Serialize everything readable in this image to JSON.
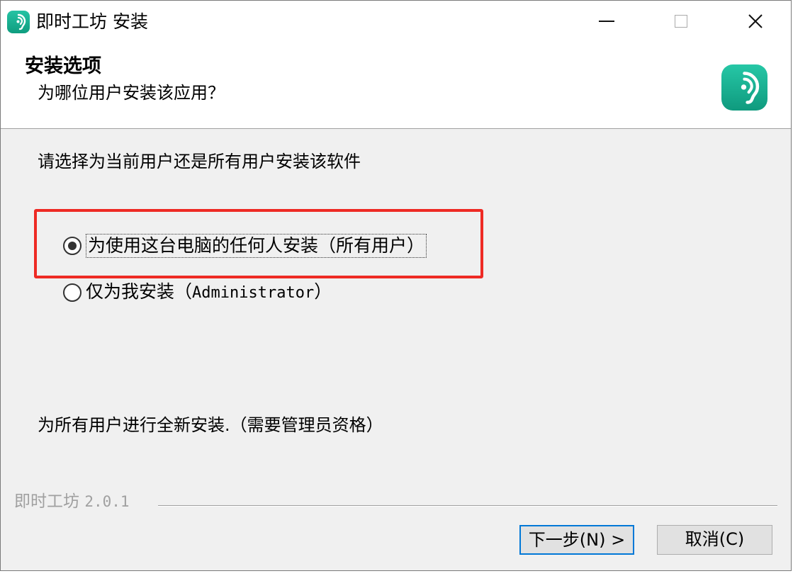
{
  "window": {
    "title": "即时工坊 安装",
    "controls": {
      "close_glyph": "✕"
    }
  },
  "header": {
    "title": "安装选项",
    "subtitle": "为哪位用户安装该应用？",
    "icon": "app-logo-icon"
  },
  "content": {
    "instruction": "请选择为当前用户还是所有用户安装该软件",
    "options": [
      {
        "label": "为使用这台电脑的任何人安装（所有用户）",
        "checked": true
      },
      {
        "label_prefix": "仅为我安装（",
        "label_mono": "Administrator",
        "label_suffix": "）",
        "checked": false
      }
    ],
    "description": "为所有用户进行全新安装.（需要管理员资格）"
  },
  "footer": {
    "product_name": "即时工坊 ",
    "version": "2.0.1",
    "next_label": "下一步(N) >",
    "cancel_label": "取消(C)"
  },
  "colors": {
    "highlight": "#ee2a24",
    "accent": "#0078d7",
    "brand": "#1ab395"
  }
}
